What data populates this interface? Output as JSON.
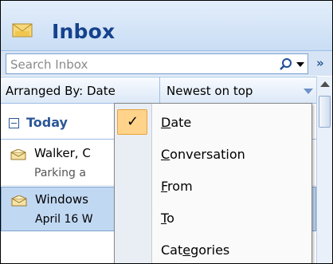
{
  "header": {
    "title": "Inbox",
    "icon": "inbox-folder-icon"
  },
  "search": {
    "placeholder": "Search Inbox"
  },
  "arrange": {
    "arranged_by": "Arranged By: Date",
    "order": "Newest on top"
  },
  "list": {
    "group_label": "Today",
    "messages": [
      {
        "sender": "Walker, C",
        "preview": "Parking a"
      },
      {
        "sender": "Windows",
        "preview": "April 16 W"
      }
    ]
  },
  "menu": {
    "items": [
      {
        "pre": "",
        "key": "D",
        "post": "ate",
        "checked": true
      },
      {
        "pre": "",
        "key": "C",
        "post": "onversation",
        "checked": false
      },
      {
        "pre": "",
        "key": "F",
        "post": "rom",
        "checked": false
      },
      {
        "pre": "",
        "key": "T",
        "post": "o",
        "checked": false
      },
      {
        "pre": "Cat",
        "key": "e",
        "post": "gories",
        "checked": false
      }
    ]
  },
  "colors": {
    "accent": "#15428b",
    "selection": "#c1d8f3",
    "menu_highlight": "#ffd38a"
  }
}
